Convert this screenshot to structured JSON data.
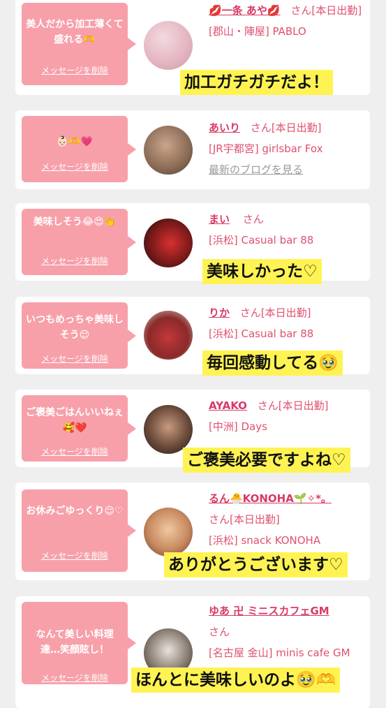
{
  "cards": [
    {
      "message": "美人だから加工薄くて盛れる🫶",
      "delete_label": "メッセージを削除",
      "name": "💋一条 あや💋",
      "san": "さん",
      "status": "[本日出勤]",
      "store": "[郡山・陣屋] PABLO",
      "caption": "加工ガチガチだよ！"
    },
    {
      "message": "👶🏻🫶💗",
      "delete_label": "メッセージを削除",
      "name": "あいり",
      "san": "さん",
      "status": "[本日出勤]",
      "store": "[JR宇都宮] girlsbar Fox",
      "blog": "最新のブログを見る"
    },
    {
      "message": "美味しそう😂😍👏",
      "delete_label": "メッセージを削除",
      "name": "まい",
      "san": "さん",
      "store": "[浜松] Casual bar 88",
      "caption": "美味しかった♡"
    },
    {
      "message": "いつもめっちゃ美味しそう😌",
      "delete_label": "メッセージを削除",
      "name": "りか",
      "san": "さん",
      "status": "[本日出勤]",
      "store": "[浜松] Casual bar 88",
      "caption": "毎回感動してる🥹"
    },
    {
      "message": "ご褒美ごはんいいねぇ🥰❤️",
      "delete_label": "メッセージを削除",
      "name": "AYAKO",
      "san": "さん",
      "status": "[本日出勤]",
      "store": "[中洲] Days",
      "caption": "ご褒美必要ですよね♡"
    },
    {
      "message": "お休みごゆっくり😌♡",
      "delete_label": "メッセージを削除",
      "name": "るん🐣KONOHA🌱✧*。",
      "san": "さん",
      "status": "[本日出勤]",
      "store": "[浜松] snack KONOHA",
      "caption": "ありがとうございます♡"
    },
    {
      "message": "なんて美しい料理達…笑顔眩し！",
      "delete_label": "メッセージを削除",
      "name": "ゆあ 卍 ミニスカフェGM",
      "san": "さん",
      "store": "[名古屋 金山] minis cafe GM",
      "caption": "ほんとに美味しいのよ🥹🫶"
    }
  ]
}
